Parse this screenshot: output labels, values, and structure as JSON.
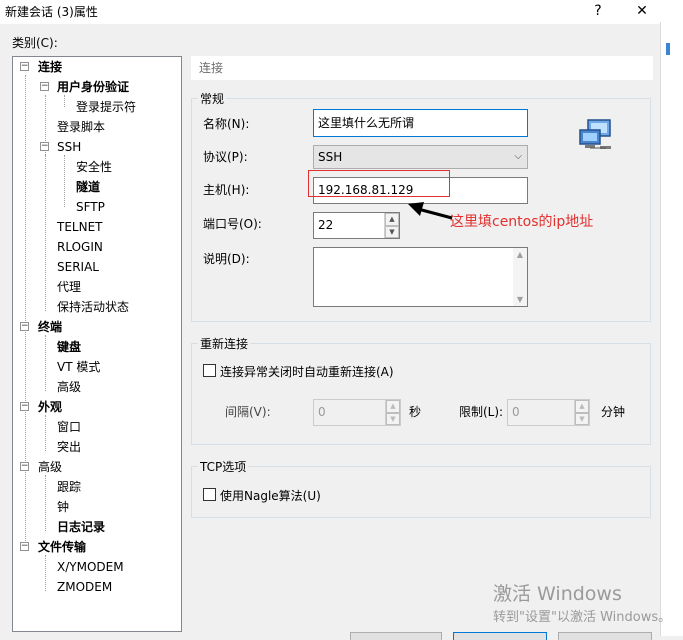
{
  "window": {
    "title": "新建会话 (3)属性",
    "help_label": "?",
    "close_label": "✕"
  },
  "category_label": "类别(C):",
  "tree": {
    "items": [
      {
        "label": "连接",
        "expander": "−"
      },
      {
        "label": "用户身份验证",
        "expander": "−"
      },
      {
        "label": "登录提示符"
      },
      {
        "label": "登录脚本"
      },
      {
        "label": "SSH",
        "expander": "−"
      },
      {
        "label": "安全性"
      },
      {
        "label": "隧道"
      },
      {
        "label": "SFTP"
      },
      {
        "label": "TELNET"
      },
      {
        "label": "RLOGIN"
      },
      {
        "label": "SERIAL"
      },
      {
        "label": "代理"
      },
      {
        "label": "保持活动状态"
      },
      {
        "label": "终端",
        "expander": "−"
      },
      {
        "label": "键盘"
      },
      {
        "label": "VT 模式"
      },
      {
        "label": "高级"
      },
      {
        "label": "外观",
        "expander": "−"
      },
      {
        "label": "窗口"
      },
      {
        "label": "突出"
      },
      {
        "label": "高级",
        "expander": "−"
      },
      {
        "label": "跟踪"
      },
      {
        "label": "钟"
      },
      {
        "label": "日志记录"
      },
      {
        "label": "文件传输",
        "expander": "−"
      },
      {
        "label": "X/YMODEM"
      },
      {
        "label": "ZMODEM"
      }
    ]
  },
  "panel": {
    "header": "连接",
    "general": {
      "title": "常规",
      "name_label": "名称(N):",
      "name_value": "这里填什么无所谓",
      "protocol_label": "协议(P):",
      "protocol_value": "SSH",
      "host_label": "主机(H):",
      "host_value": "192.168.81.129",
      "port_label": "端口号(O):",
      "port_value": "22",
      "desc_label": "说明(D):",
      "desc_value": ""
    },
    "reconnect": {
      "title": "重新连接",
      "checkbox_label": "连接异常关闭时自动重新连接(A)",
      "interval_label": "间隔(V):",
      "interval_value": "0",
      "interval_unit": "秒",
      "limit_label": "限制(L):",
      "limit_value": "0",
      "limit_unit": "分钟"
    },
    "tcp": {
      "title": "TCP选项",
      "nagle_label": "使用Nagle算法(U)"
    }
  },
  "annotation": {
    "text": "这里填centos的ip地址",
    "color": "#e0302f"
  },
  "watermark": {
    "line1": "激活 Windows",
    "line2": "转到\"设置\"以激活 Windows。"
  }
}
